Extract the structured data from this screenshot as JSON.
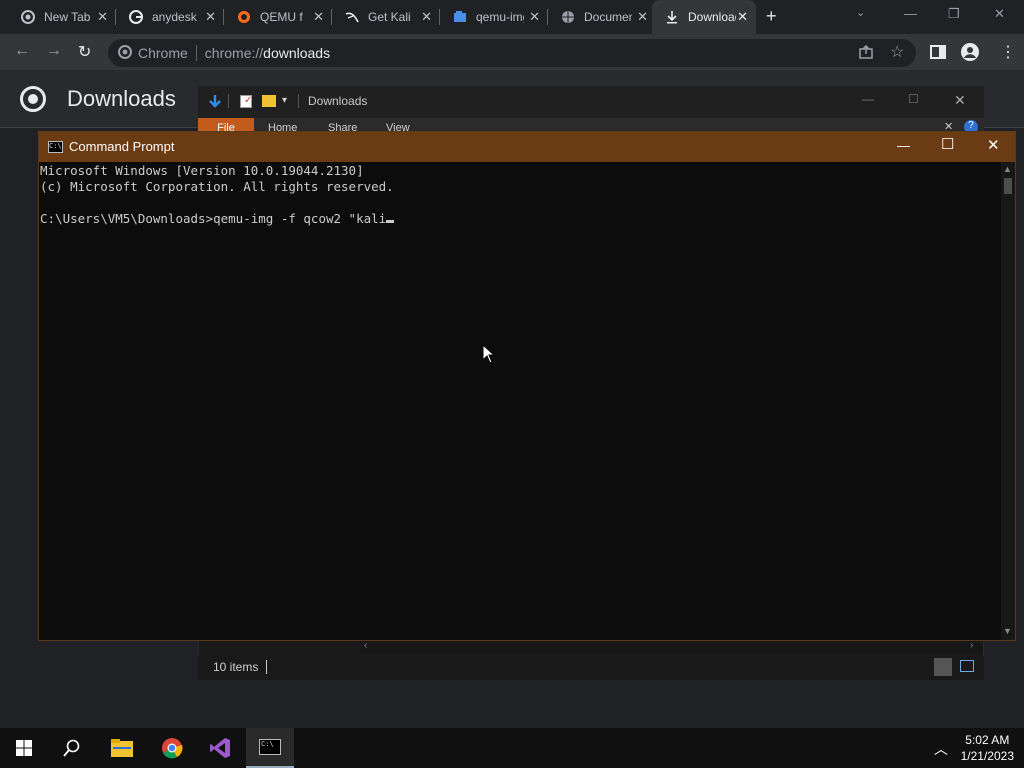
{
  "browser": {
    "tabs": [
      {
        "title": "New Tab",
        "icon": "chrome-icon"
      },
      {
        "title": "anydesk",
        "icon": "google-icon"
      },
      {
        "title": "QEMU f",
        "icon": "qemu-icon"
      },
      {
        "title": "Get Kali",
        "icon": "kali-icon"
      },
      {
        "title": "qemu-img",
        "icon": "doc-icon"
      },
      {
        "title": "Documen",
        "icon": "globe-icon"
      },
      {
        "title": "Downloads",
        "icon": "download-icon"
      }
    ],
    "omnibox": {
      "site_label": "Chrome",
      "url_scheme": "chrome://",
      "url_host": "downloads"
    }
  },
  "downloads_page": {
    "title": "Downloads"
  },
  "explorer": {
    "title": "Downloads",
    "ribbon_tabs": [
      "File",
      "Home",
      "Share",
      "View"
    ],
    "status": "10 items"
  },
  "cmd": {
    "title": "Command Prompt",
    "lines": [
      "Microsoft Windows [Version 10.0.19044.2130]",
      "(c) Microsoft Corporation. All rights reserved.",
      "",
      "C:\\Users\\VM5\\Downloads>qemu-img -f qcow2 \"kali"
    ]
  },
  "taskbar": {
    "time": "5:02 AM",
    "date": "1/21/2023"
  }
}
